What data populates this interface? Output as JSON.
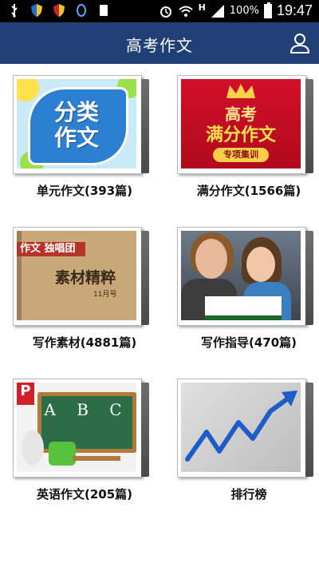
{
  "status_bar": {
    "battery_percent": "100%",
    "time": "19:47",
    "network_letter": "H",
    "icons": [
      "usb-icon",
      "shield-icon",
      "shield-icon",
      "qq-icon",
      "sim-icon",
      "alarm-icon",
      "wifi-icon",
      "signal-icon",
      "battery-icon"
    ]
  },
  "app_bar": {
    "title": "高考作文",
    "user_icon": "user-icon"
  },
  "tiles": [
    {
      "caption": "单元作文(393篇)",
      "cover_text": [
        "分类",
        "作文"
      ]
    },
    {
      "caption": "满分作文(1566篇)",
      "cover_text": [
        "高考",
        "满分作文",
        "专项集训"
      ]
    },
    {
      "caption": "写作素材(4881篇)",
      "cover_text": [
        "独唱团",
        "素材精粹",
        "11月号",
        "作文"
      ]
    },
    {
      "caption": "写作指导(470篇)",
      "cover_text": []
    },
    {
      "caption": "英语作文(205篇)",
      "cover_text": [
        "A B C",
        "P"
      ]
    },
    {
      "caption": "排行榜",
      "cover_text": []
    }
  ],
  "colors": {
    "app_bar": "#1f3f75",
    "status_bar": "#000000",
    "chart_arrow": "#1e5cc8"
  }
}
